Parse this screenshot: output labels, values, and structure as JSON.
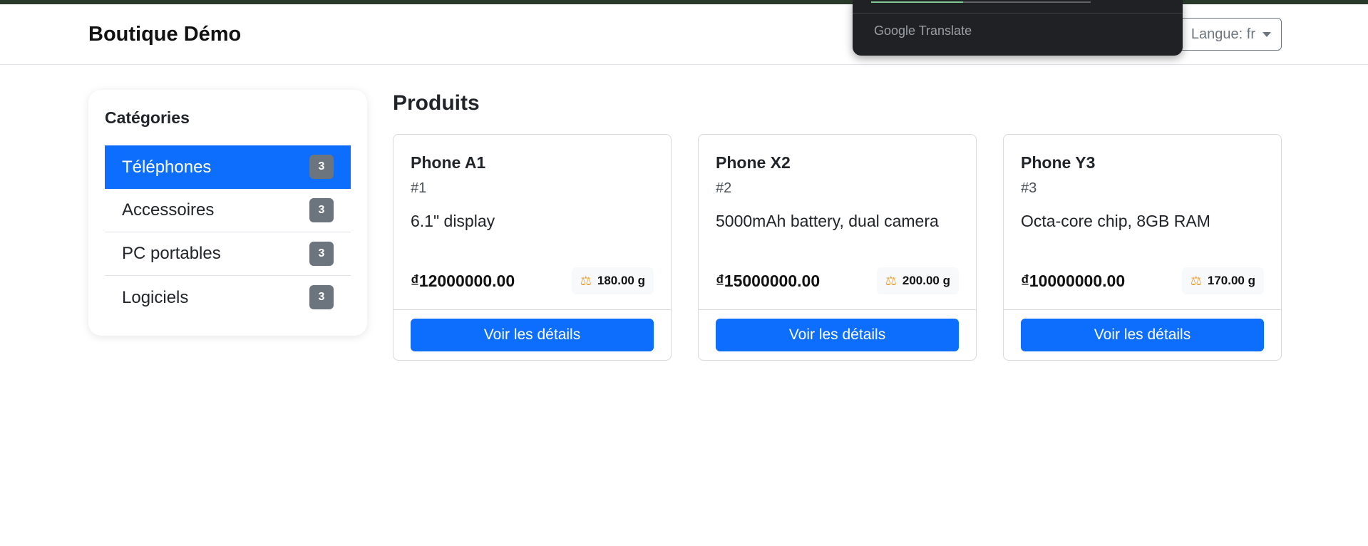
{
  "navbar": {
    "brand": "Boutique Démo",
    "language_button": "Langue: fr"
  },
  "translate_popup": {
    "brand": "Google Translate",
    "progress": 0.42
  },
  "sidebar": {
    "title": "Catégories",
    "items": [
      {
        "label": "Téléphones",
        "count": "3",
        "active": true
      },
      {
        "label": "Accessoires",
        "count": "3",
        "active": false
      },
      {
        "label": "PC portables",
        "count": "3",
        "active": false
      },
      {
        "label": "Logiciels",
        "count": "3",
        "active": false
      }
    ]
  },
  "products": {
    "title": "Produits",
    "items": [
      {
        "name": "Phone A1",
        "id": "#1",
        "description": "6.1\" display",
        "price": "₫12000000.00",
        "weight": "180.00 g",
        "button": "Voir les détails"
      },
      {
        "name": "Phone X2",
        "id": "#2",
        "description": "5000mAh battery, dual camera",
        "price": "₫15000000.00",
        "weight": "200.00 g",
        "button": "Voir les détails"
      },
      {
        "name": "Phone Y3",
        "id": "#3",
        "description": "Octa-core chip, 8GB RAM",
        "price": "₫10000000.00",
        "weight": "170.00 g",
        "button": "Voir les détails"
      }
    ]
  },
  "colors": {
    "primary": "#0d6efd",
    "badge": "#6c757d",
    "translate_bg": "#202124",
    "translate_progress": "#81c995"
  },
  "icons": {
    "weight": "scale-icon",
    "language_dropdown": "caret-down-icon"
  }
}
